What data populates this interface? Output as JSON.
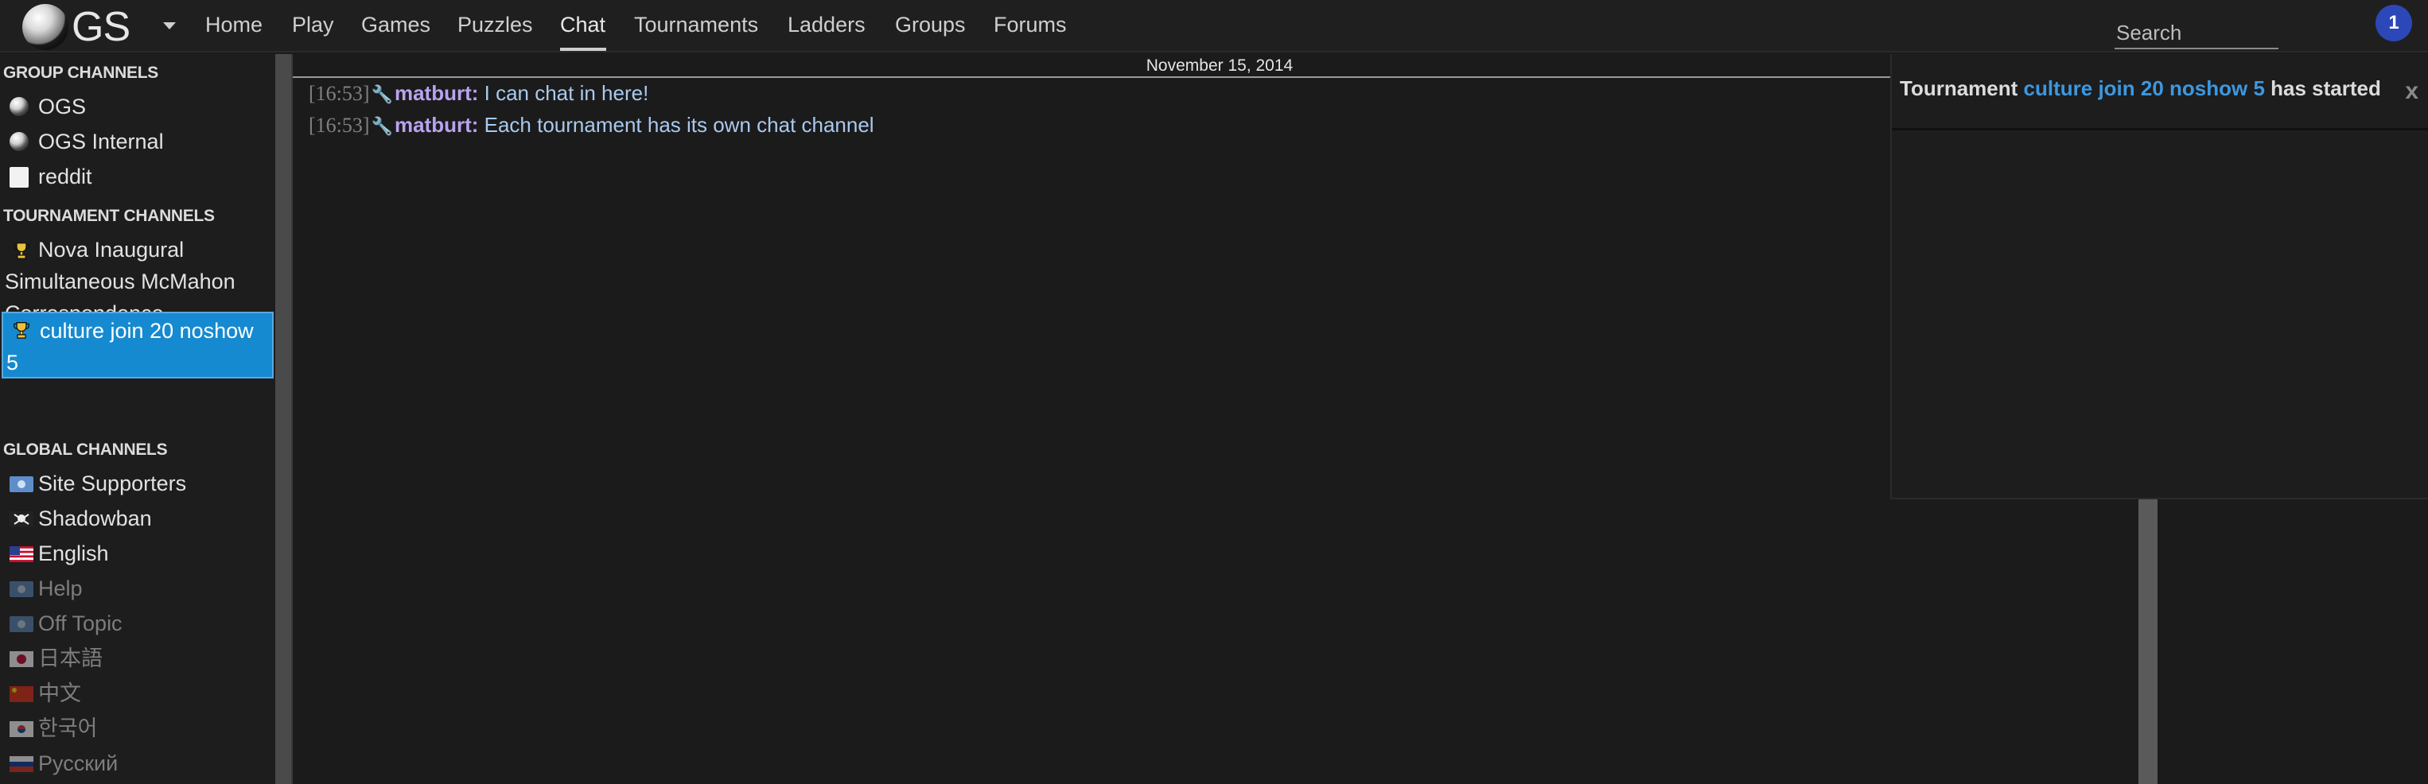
{
  "nav": {
    "logo_text": "GS",
    "links": [
      {
        "label": "Home"
      },
      {
        "label": "Play"
      },
      {
        "label": "Games"
      },
      {
        "label": "Puzzles"
      },
      {
        "label": "Chat"
      },
      {
        "label": "Tournaments"
      },
      {
        "label": "Ladders"
      },
      {
        "label": "Groups"
      },
      {
        "label": "Forums"
      }
    ],
    "active_link": "Chat",
    "search_placeholder": "Search",
    "notification_count": "1"
  },
  "sidebar": {
    "group_heading": "GROUP CHANNELS",
    "group_channels": [
      {
        "label": "OGS",
        "icon": "ogs-stone-icon"
      },
      {
        "label": "OGS Internal",
        "icon": "ogs-stone-icon"
      },
      {
        "label": "reddit",
        "icon": "reddit-icon"
      }
    ],
    "tournament_heading": "TOURNAMENT CHANNELS",
    "tournament_channels": [
      {
        "label": "Nova Inaugural Simultaneous McMahon Correspondence Tournament",
        "icon": "trophy-icon",
        "selected": false
      },
      {
        "label": "culture join 20 noshow 5",
        "icon": "trophy-icon",
        "selected": true
      }
    ],
    "global_heading": "GLOBAL CHANNELS",
    "global_channels": [
      {
        "label": "Site Supporters",
        "icon": "supporter-icon",
        "joined": true
      },
      {
        "label": "Shadowban",
        "icon": "skull-flag-icon",
        "joined": true
      },
      {
        "label": "English",
        "icon": "us-flag-icon",
        "joined": true
      },
      {
        "label": "Help",
        "icon": "help-flag-icon",
        "joined": false
      },
      {
        "label": "Off Topic",
        "icon": "offtopic-flag-icon",
        "joined": false
      },
      {
        "label": "日本語",
        "icon": "japan-flag-icon",
        "joined": false
      },
      {
        "label": "中文",
        "icon": "china-flag-icon",
        "joined": false
      },
      {
        "label": "한국어",
        "icon": "korea-flag-icon",
        "joined": false
      },
      {
        "label": "Русский",
        "icon": "russia-flag-icon",
        "joined": false
      }
    ]
  },
  "chat": {
    "date": "November 15, 2014",
    "messages": [
      {
        "time": "[16:53]",
        "user": "matburt:",
        "text": "I can chat in here!"
      },
      {
        "time": "[16:53]",
        "user": "matburt:",
        "text": "Each tournament has its own chat channel"
      }
    ]
  },
  "notification": {
    "prefix": "Tournament",
    "link": "culture join 20 noshow 5",
    "suffix": "has started",
    "close_label": "x"
  },
  "colors": {
    "accent_selected": "#168ad0",
    "link_blue": "#3c98e0",
    "badge_blue": "#2c47b8",
    "username_purple": "#b9a3f0",
    "message_text": "#a9c9ee"
  }
}
